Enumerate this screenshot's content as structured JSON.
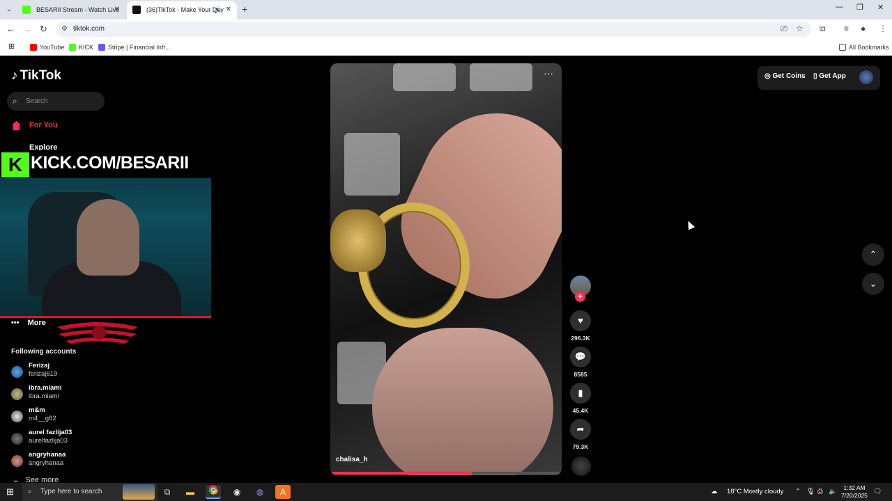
{
  "browser": {
    "tabs": [
      {
        "title": "BESARII Stream - Watch Live on"
      },
      {
        "title": "(36)TikTok - Make Your Day"
      }
    ],
    "new_tab_icon": "+",
    "url": "tiktok.com",
    "bookmarks": [
      {
        "label": "YouTube",
        "color": "#ff0000"
      },
      {
        "label": "KICK",
        "color": "#53fc18"
      },
      {
        "label": "Stripe | Financial Infr...",
        "color": "#635bff"
      }
    ],
    "all_bookmarks": "All Bookmarks"
  },
  "tiktok": {
    "logo": "TikTok",
    "search_placeholder": "Search",
    "nav": {
      "for_you": "For You",
      "explore": "Explore",
      "more": "More"
    },
    "stream_overlay": {
      "k": "K",
      "text": "KICK.COM/BESARII"
    },
    "following_header": "Following accounts",
    "following": [
      {
        "name": "Ferizaj",
        "handle": "ferizaj619"
      },
      {
        "name": "ibra.miami",
        "handle": "ibra.miami"
      },
      {
        "name": "m&m",
        "handle": "m4__g82"
      },
      {
        "name": "aurel fazlija03",
        "handle": "aurelfazlija03"
      },
      {
        "name": "angryhanaa",
        "handle": "angryhanaa"
      }
    ],
    "see_more": "See more",
    "video": {
      "author": "chalisa_h",
      "menu": "···",
      "progress": 0.61
    },
    "actions": {
      "likes": "296.3K",
      "comments": "8585",
      "saves": "45.4K",
      "shares": "79.3K"
    },
    "top_right": {
      "get_coins": "Get Coins",
      "get_app": "Get App"
    }
  },
  "taskbar": {
    "search_placeholder": "Type here to search",
    "weather": "18°C  Mostly cloudy",
    "time": "1:32 AM",
    "date": "7/20/2025"
  },
  "colors": {
    "accent": "#fe2c55",
    "kick_green": "#53fc18"
  }
}
